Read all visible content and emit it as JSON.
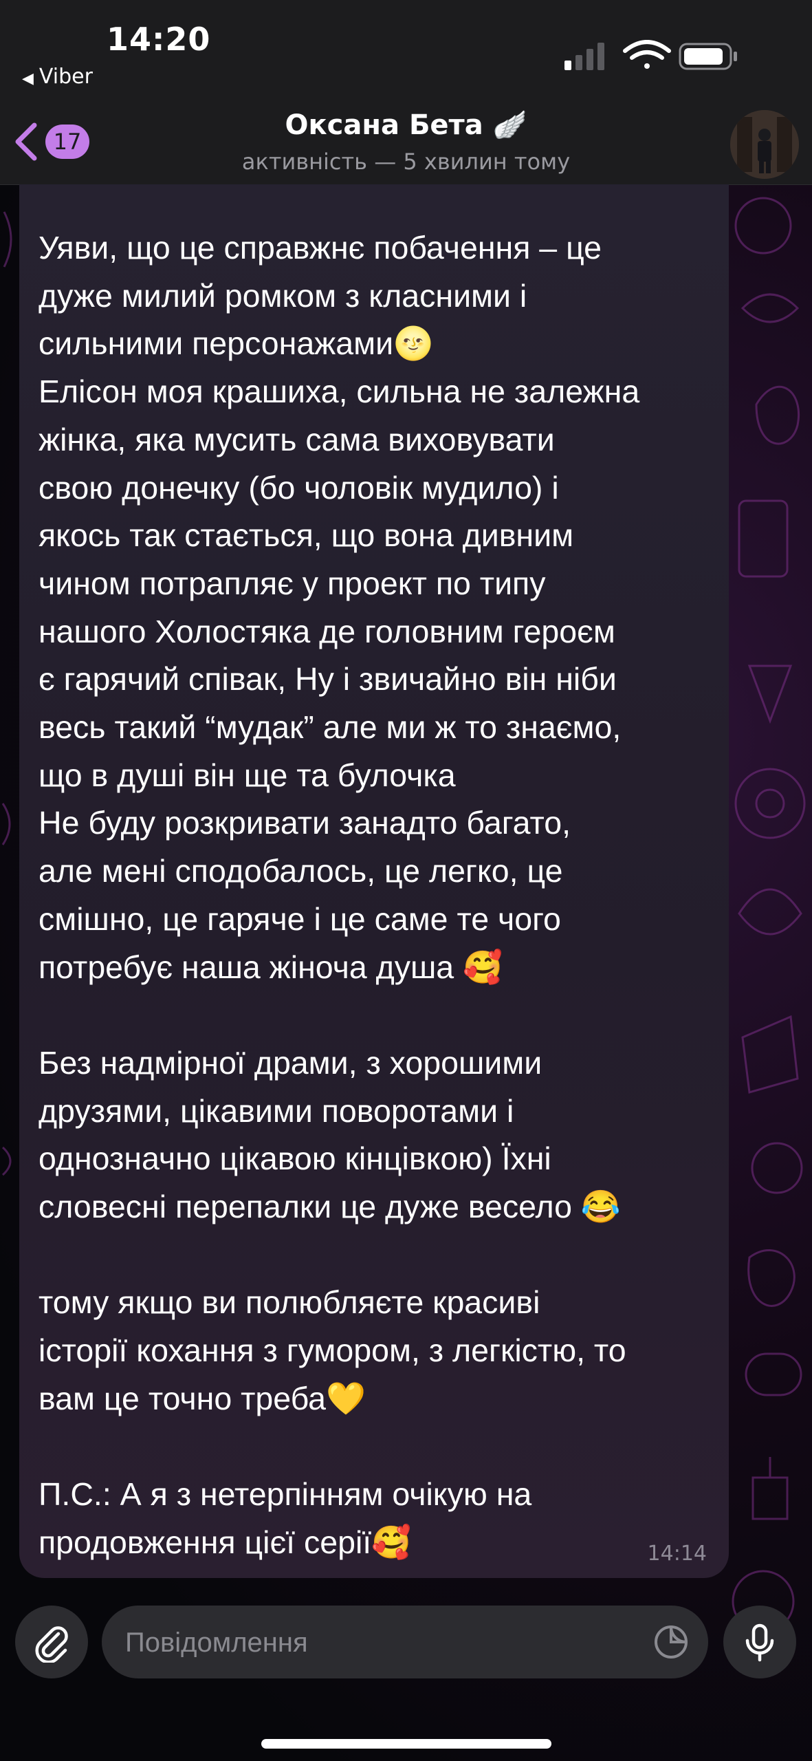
{
  "status_bar": {
    "time": "14:20",
    "back_app_label": "Viber"
  },
  "header": {
    "unread_count": "17",
    "title": "Оксана Бета 🪽",
    "subtitle": "активність — 5 хвилин тому"
  },
  "message": {
    "text": "Уяви, що це справжнє побачення – це\nдуже милий ромком з класними і\nсильними персонажами🌝\nЕлісон моя крашиха, сильна не залежна\nжінка, яка мусить сама виховувати\nсвою донечку (бо чоловік мудило) і\nякось так стається, що вона дивним\nчином потрапляє у проект по типу\nнашого Холостяка де головним героєм\nє гарячий співак, Ну і звичайно він ніби\nвесь такий “мудак” але ми ж то знаємо,\nщо в душі він ще та булочка\nНе буду розкривати занадто багато,\nале мені сподобалось, це легко, це\nсмішно, це гаряче і це саме те чого\nпотребує наша жіноча душа 🥰\n\nБез надмірної драми, з хорошими\nдрузями, цікавими поворотами і\nоднозначно цікавою кінцівкою) Їхні\nсловесні перепалки це дуже весело 😂\n\nтому якщо ви полюбляєте красиві\nісторії кохання з гумором, з легкістю, то\nвам це точно треба💛\n\nП.С.: А я з нетерпінням очікую на\nпродовження цієї серії🥰",
    "time": "14:14"
  },
  "input": {
    "placeholder": "Повідомлення"
  },
  "colors": {
    "accent": "#c37de8",
    "bar_background": "#1c1c1e",
    "bubble_background": "#262230"
  },
  "icons": [
    "signal-icon",
    "wifi-icon",
    "battery-icon",
    "chevron-left-icon",
    "paperclip-icon",
    "sticker-icon",
    "microphone-icon"
  ]
}
